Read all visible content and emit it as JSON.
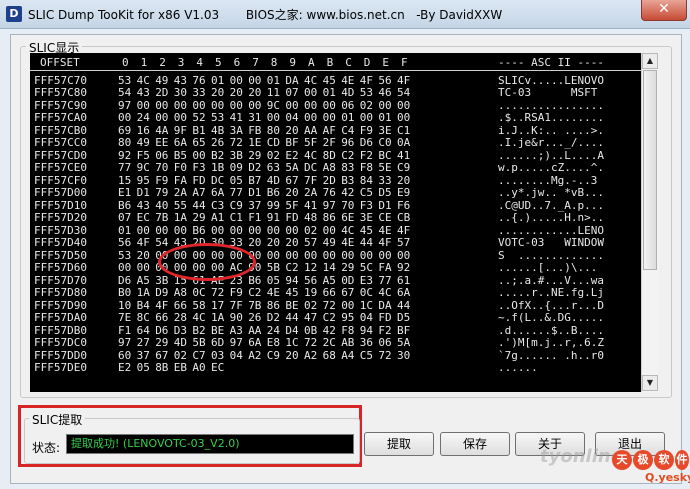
{
  "window": {
    "title": "SLIC Dump TooKit for x86 V1.03       BIOS之家: www.bios.net.cn   -By DavidXXW",
    "app_icon": "D",
    "close_glyph": "✕"
  },
  "slic_group": {
    "label": "SLIC显示",
    "header": {
      "offset": "OFFSET",
      "columns": [
        "0",
        "1",
        "2",
        "3",
        "4",
        "5",
        "6",
        "7",
        "8",
        "9",
        "A",
        "B",
        "C",
        "D",
        "E",
        "F"
      ],
      "ascii": "---- ASC II ----"
    },
    "rows": [
      {
        "addr": "FFF57C70",
        "bytes": [
          "53",
          "4C",
          "49",
          "43",
          "76",
          "01",
          "00",
          "00",
          "01",
          "DA",
          "4C",
          "45",
          "4E",
          "4F",
          "56",
          "4F"
        ],
        "ascii": "SLICv.....LENOVO"
      },
      {
        "addr": "FFF57C80",
        "bytes": [
          "54",
          "43",
          "2D",
          "30",
          "33",
          "20",
          "20",
          "20",
          "11",
          "07",
          "00",
          "01",
          "4D",
          "53",
          "46",
          "54"
        ],
        "ascii": "TC-03      MSFT"
      },
      {
        "addr": "FFF57C90",
        "bytes": [
          "97",
          "00",
          "00",
          "00",
          "00",
          "00",
          "00",
          "00",
          "9C",
          "00",
          "00",
          "00",
          "06",
          "02",
          "00",
          "00"
        ],
        "ascii": "................"
      },
      {
        "addr": "FFF57CA0",
        "bytes": [
          "00",
          "24",
          "00",
          "00",
          "52",
          "53",
          "41",
          "31",
          "00",
          "04",
          "00",
          "00",
          "01",
          "00",
          "01",
          "00"
        ],
        "ascii": ".$..RSA1........"
      },
      {
        "addr": "FFF57CB0",
        "bytes": [
          "69",
          "16",
          "4A",
          "9F",
          "B1",
          "4B",
          "3A",
          "FB",
          "80",
          "20",
          "AA",
          "AF",
          "C4",
          "F9",
          "3E",
          "C1"
        ],
        "ascii": "i.J..K:.. ....>."
      },
      {
        "addr": "FFF57CC0",
        "bytes": [
          "80",
          "49",
          "EE",
          "6A",
          "65",
          "26",
          "72",
          "1E",
          "CD",
          "BF",
          "5F",
          "2F",
          "96",
          "D6",
          "C0",
          "0A"
        ],
        "ascii": ".I.je&r..._/...."
      },
      {
        "addr": "FFF57CD0",
        "bytes": [
          "92",
          "F5",
          "06",
          "B5",
          "00",
          "B2",
          "3B",
          "29",
          "02",
          "E2",
          "4C",
          "8D",
          "C2",
          "F2",
          "BC",
          "41"
        ],
        "ascii": "......;)..L....A"
      },
      {
        "addr": "FFF57CE0",
        "bytes": [
          "77",
          "9C",
          "70",
          "F0",
          "F3",
          "1B",
          "09",
          "D2",
          "63",
          "5A",
          "DC",
          "A8",
          "83",
          "F8",
          "5E",
          "C9"
        ],
        "ascii": "w.p.....cZ....^."
      },
      {
        "addr": "FFF57CF0",
        "bytes": [
          "15",
          "95",
          "F9",
          "FA",
          "FD",
          "DC",
          "05",
          "B7",
          "4D",
          "67",
          "7F",
          "2D",
          "B3",
          "84",
          "33",
          "20"
        ],
        "ascii": "........Mg.-..3 "
      },
      {
        "addr": "FFF57D00",
        "bytes": [
          "E1",
          "D1",
          "79",
          "2A",
          "A7",
          "6A",
          "77",
          "D1",
          "B6",
          "20",
          "2A",
          "76",
          "42",
          "C5",
          "D5",
          "E9"
        ],
        "ascii": "..y*.jw.. *vB..."
      },
      {
        "addr": "FFF57D10",
        "bytes": [
          "B6",
          "43",
          "40",
          "55",
          "44",
          "C3",
          "C9",
          "37",
          "99",
          "5F",
          "41",
          "97",
          "70",
          "F3",
          "D1",
          "F6"
        ],
        "ascii": ".C@UD..7._A.p..."
      },
      {
        "addr": "FFF57D20",
        "bytes": [
          "07",
          "EC",
          "7B",
          "1A",
          "29",
          "A1",
          "C1",
          "F1",
          "91",
          "FD",
          "48",
          "86",
          "6E",
          "3E",
          "CE",
          "CB"
        ],
        "ascii": "..{.).....H.n>.."
      },
      {
        "addr": "FFF57D30",
        "bytes": [
          "01",
          "00",
          "00",
          "00",
          "B6",
          "00",
          "00",
          "00",
          "00",
          "00",
          "02",
          "00",
          "4C",
          "45",
          "4E",
          "4F"
        ],
        "ascii": "............LENO"
      },
      {
        "addr": "FFF57D40",
        "bytes": [
          "56",
          "4F",
          "54",
          "43",
          "2D",
          "30",
          "33",
          "20",
          "20",
          "20",
          "57",
          "49",
          "4E",
          "44",
          "4F",
          "57"
        ],
        "ascii": "VOTC-03   WINDOW"
      },
      {
        "addr": "FFF57D50",
        "bytes": [
          "53",
          "20",
          "00",
          "00",
          "00",
          "00",
          "00",
          "00",
          "00",
          "00",
          "00",
          "00",
          "00",
          "00",
          "00",
          "00"
        ],
        "ascii": "S  ............."
      },
      {
        "addr": "FFF57D60",
        "bytes": [
          "00",
          "00",
          "00",
          "00",
          "00",
          "00",
          "AC",
          "90",
          "5B",
          "C2",
          "12",
          "14",
          "29",
          "5C",
          "FA",
          "92"
        ],
        "ascii": "......[...)\\..."
      },
      {
        "addr": "FFF57D70",
        "bytes": [
          "D6",
          "A5",
          "3B",
          "15",
          "61",
          "AE",
          "23",
          "B6",
          "05",
          "94",
          "56",
          "A5",
          "0D",
          "E3",
          "77",
          "61"
        ],
        "ascii": "..;.a.#...V...wa"
      },
      {
        "addr": "FFF57D80",
        "bytes": [
          "B0",
          "1A",
          "D9",
          "A8",
          "0C",
          "72",
          "F9",
          "C2",
          "4E",
          "45",
          "19",
          "66",
          "67",
          "0C",
          "4C",
          "6A"
        ],
        "ascii": ".....r..NE.fg.Lj"
      },
      {
        "addr": "FFF57D90",
        "bytes": [
          "10",
          "B4",
          "4F",
          "66",
          "58",
          "17",
          "7F",
          "7B",
          "86",
          "BE",
          "02",
          "72",
          "00",
          "1C",
          "DA",
          "44"
        ],
        "ascii": "..OfX..{...r...D"
      },
      {
        "addr": "FFF57DA0",
        "bytes": [
          "7E",
          "8C",
          "66",
          "28",
          "4C",
          "1A",
          "90",
          "26",
          "D2",
          "44",
          "47",
          "C2",
          "95",
          "04",
          "FD",
          "D5"
        ],
        "ascii": "~.f(L..&.DG....."
      },
      {
        "addr": "FFF57DB0",
        "bytes": [
          "F1",
          "64",
          "D6",
          "D3",
          "B2",
          "BE",
          "A3",
          "AA",
          "24",
          "D4",
          "0B",
          "42",
          "F8",
          "94",
          "F2",
          "BF"
        ],
        "ascii": ".d......$..B...."
      },
      {
        "addr": "FFF57DC0",
        "bytes": [
          "97",
          "27",
          "29",
          "4D",
          "5B",
          "6D",
          "97",
          "6A",
          "E8",
          "1C",
          "72",
          "2C",
          "AB",
          "36",
          "06",
          "5A"
        ],
        "ascii": ".')M[m.j..r,.6.Z"
      },
      {
        "addr": "FFF57DD0",
        "bytes": [
          "60",
          "37",
          "67",
          "02",
          "C7",
          "03",
          "04",
          "A2",
          "C9",
          "20",
          "A2",
          "68",
          "A4",
          "C5",
          "72",
          "30"
        ],
        "ascii": "`7g...... .h..r0"
      },
      {
        "addr": "FFF57DE0",
        "bytes": [
          "E2",
          "05",
          "8B",
          "EB",
          "A0",
          "EC",
          "",
          "",
          "",
          "",
          "",
          "",
          "",
          "",
          "",
          ""
        ],
        "ascii": "......"
      }
    ]
  },
  "scrollbar": {
    "up_glyph": "▲",
    "down_glyph": "▼"
  },
  "extract_group": {
    "label": "SLIC提取",
    "status_label": "状态:",
    "status_value": "提取成功! (LENOVOTC-03_V2.0)"
  },
  "buttons": {
    "extract": "提取",
    "save": "保存",
    "about": "关于",
    "exit": "退出"
  },
  "watermark": {
    "brand": "tyonline",
    "chars": [
      "天",
      "极",
      "软",
      "件"
    ],
    "url": "Q.yesky.com"
  }
}
